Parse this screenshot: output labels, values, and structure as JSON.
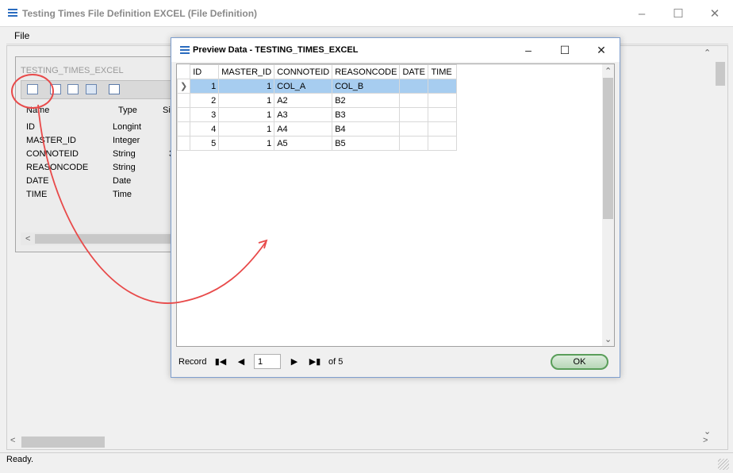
{
  "app": {
    "title": "Testing Times File Definition EXCEL (File Definition)",
    "menu": [
      "File"
    ],
    "status": "Ready."
  },
  "file_window": {
    "title": "TESTING_TIMES_EXCEL",
    "columns": [
      "Name",
      "Type",
      "Si"
    ],
    "fields": [
      {
        "name": "ID",
        "type": "Longint",
        "size": ""
      },
      {
        "name": "MASTER_ID",
        "type": "Integer",
        "size": ""
      },
      {
        "name": "CONNOTEID",
        "type": "String",
        "size": "3"
      },
      {
        "name": "REASONCODE",
        "type": "String",
        "size": ""
      },
      {
        "name": "DATE",
        "type": "Date",
        "size": ""
      },
      {
        "name": "TIME",
        "type": "Time",
        "size": ""
      }
    ],
    "toolbar_icons": [
      "preview-data-icon",
      "list-icon",
      "form-icon",
      "calculator-icon",
      "export-icon"
    ]
  },
  "dialog": {
    "title": "Preview Data - TESTING_TIMES_EXCEL",
    "columns": [
      "ID",
      "MASTER_ID",
      "CONNOTEID",
      "REASONCODE",
      "DATE",
      "TIME"
    ],
    "rows": [
      [
        "1",
        "1",
        "COL_A",
        "COL_B",
        "",
        ""
      ],
      [
        "2",
        "1",
        "A2",
        "B2",
        "",
        ""
      ],
      [
        "3",
        "1",
        "A3",
        "B3",
        "",
        ""
      ],
      [
        "4",
        "1",
        "A4",
        "B4",
        "",
        ""
      ],
      [
        "5",
        "1",
        "A5",
        "B5",
        "",
        ""
      ]
    ],
    "selected_row": 0,
    "nav": {
      "record_label": "Record",
      "current": "1",
      "of_label": "of 5"
    },
    "ok_label": "OK"
  },
  "colors": {
    "selection": "#a7cdf0",
    "annotation": "#e84a4a",
    "ok_border": "#5a9e5a"
  }
}
